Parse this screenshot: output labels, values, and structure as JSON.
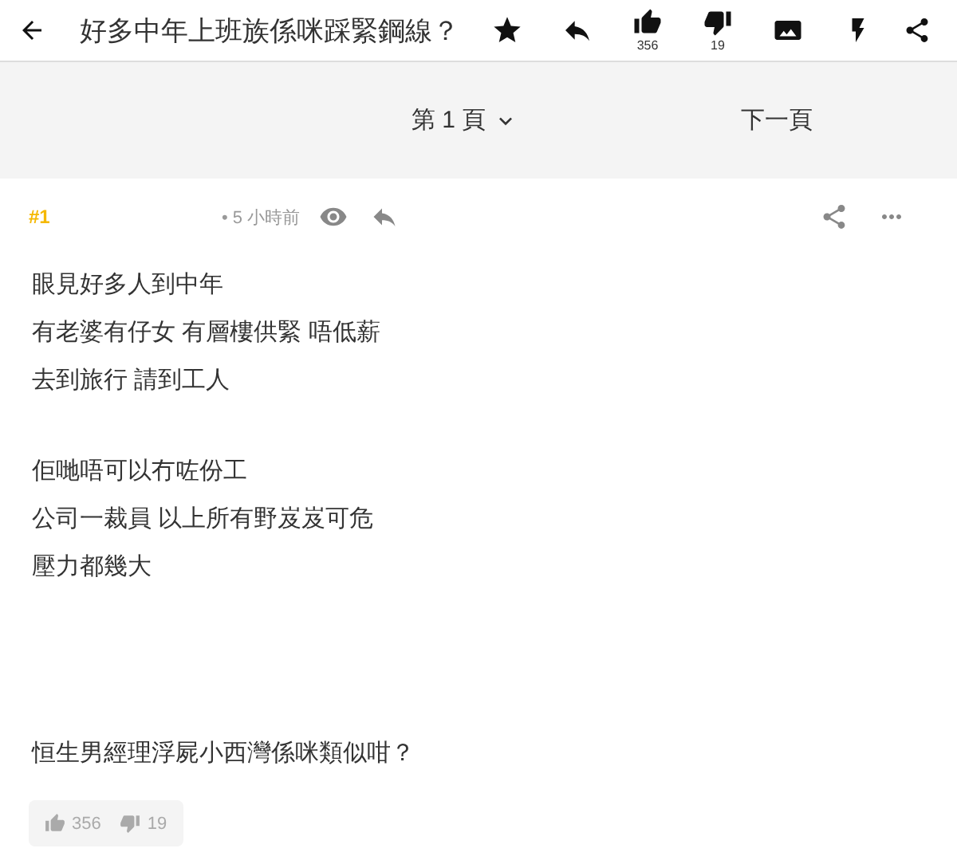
{
  "header": {
    "title": "好多中年上班族係咪踩緊鋼線？",
    "likes": "356",
    "dislikes": "19"
  },
  "pager": {
    "page": "第 1 頁",
    "next": "下一頁"
  },
  "post": {
    "floor": "#1",
    "time": "• 5 小時前",
    "paragraphs": [
      {
        "lines": [
          "眼見好多人到中年",
          "有老婆有仔女 有層樓供緊 唔低薪",
          "去到旅行 請到工人"
        ]
      },
      {
        "lines": [
          "佢哋唔可以冇咗份工",
          "公司一裁員 以上所有野岌岌可危",
          "壓力都幾大"
        ]
      },
      {
        "lines": [
          "恒生男經理浮屍小西灣係咪類似咁？"
        ]
      }
    ],
    "likes": "356",
    "dislikes": "19"
  }
}
